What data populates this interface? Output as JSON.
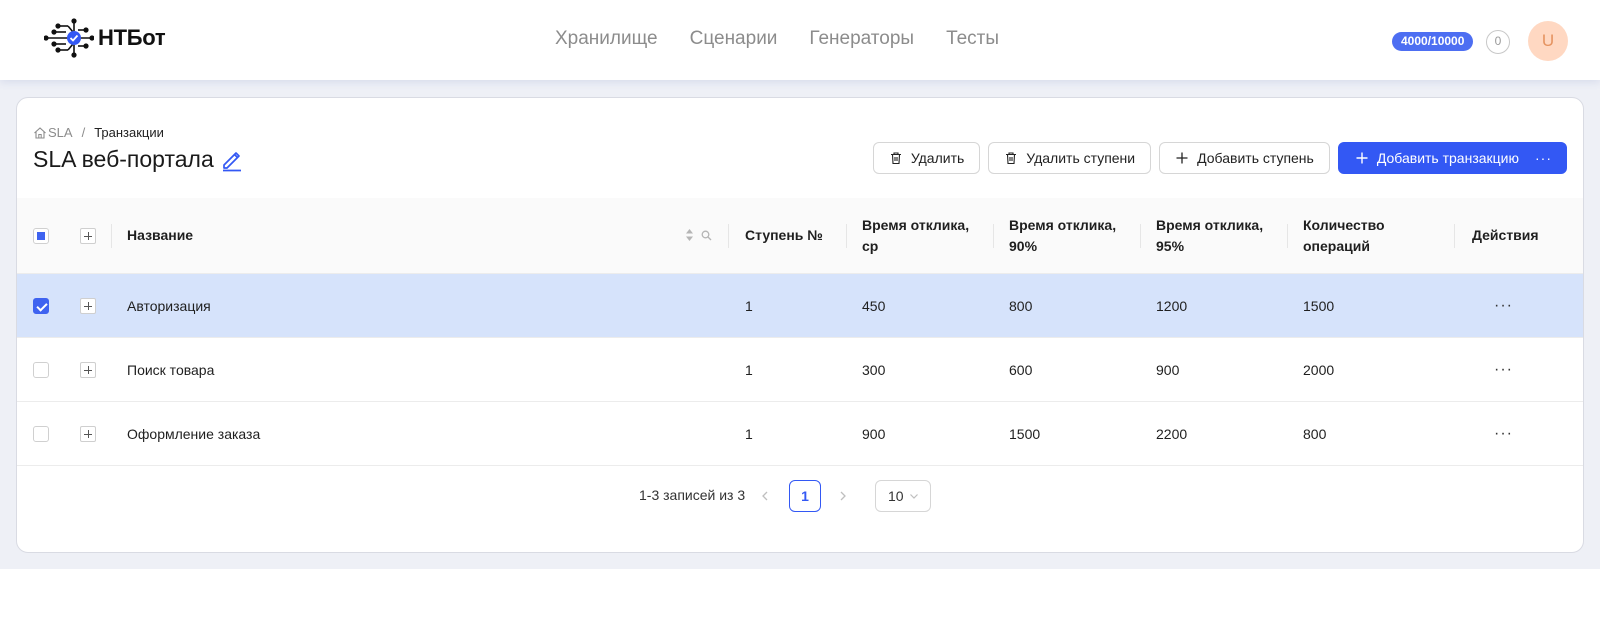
{
  "app": {
    "name": "НТБот"
  },
  "nav": [
    "Хранилище",
    "Сценарии",
    "Генераторы",
    "Тесты"
  ],
  "header": {
    "quota": "4000/10000",
    "notifications": "0",
    "avatar_letter": "U"
  },
  "breadcrumb": {
    "root": "SLA",
    "current": "Транзакции"
  },
  "page": {
    "title": "SLA веб-портала"
  },
  "actions": {
    "delete": "Удалить",
    "delete_steps": "Удалить ступени",
    "add_step": "Добавить ступень",
    "add_transaction": "Добавить транзакцию",
    "more": "···"
  },
  "table": {
    "columns": {
      "name": "Название",
      "step": "Ступень №",
      "resp_avg": "Время отклика, ср",
      "resp_90": "Время отклика, 90%",
      "resp_95": "Время отклика, 95%",
      "ops": "Количество операций",
      "actions": "Действия"
    },
    "rows": [
      {
        "name": "Авторизация",
        "step": "1",
        "resp_avg": "450",
        "resp_90": "800",
        "resp_95": "1200",
        "ops": "1500",
        "actions": "···",
        "selected": true
      },
      {
        "name": "Поиск товара",
        "step": "1",
        "resp_avg": "300",
        "resp_90": "600",
        "resp_95": "900",
        "ops": "2000",
        "actions": "···",
        "selected": false
      },
      {
        "name": "Оформление заказа",
        "step": "1",
        "resp_avg": "900",
        "resp_90": "1500",
        "resp_95": "2200",
        "ops": "800",
        "actions": "···",
        "selected": false
      }
    ]
  },
  "pagination": {
    "total": "1-3 записей из 3",
    "page": "1",
    "page_size": "10"
  },
  "colors": {
    "primary": "#3358f4",
    "selected_row": "#d6e3fb",
    "quota_badge": "#4d6ef2",
    "avatar_bg": "#ffd8c2"
  },
  "icons": [
    "logo-icon",
    "home-icon",
    "edit-icon",
    "trash-icon",
    "plus-icon",
    "sort-icon",
    "search-icon",
    "chevron-left-icon",
    "chevron-right-icon",
    "chevron-down-icon"
  ]
}
